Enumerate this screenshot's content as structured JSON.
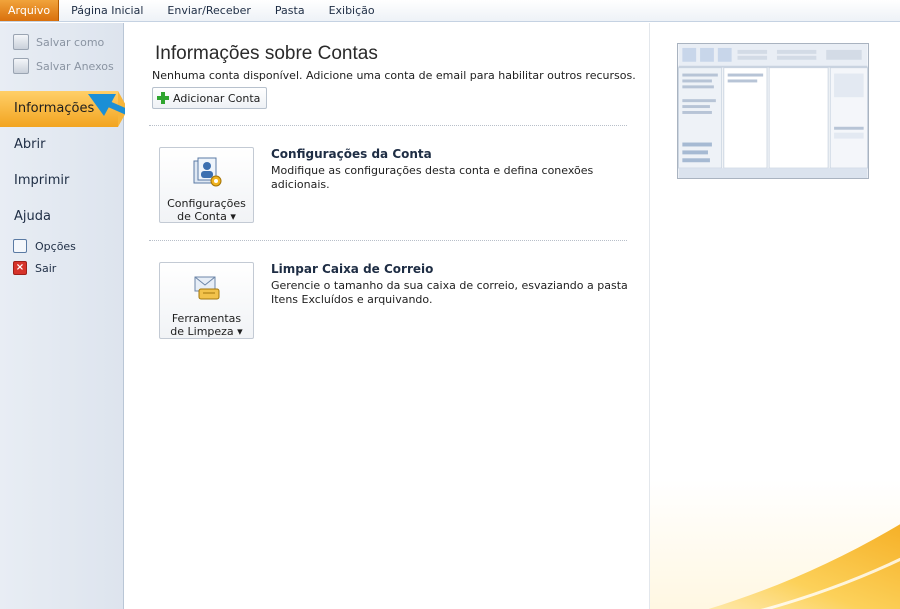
{
  "ribbon": {
    "tabs": [
      "Arquivo",
      "Página Inicial",
      "Enviar/Receber",
      "Pasta",
      "Exibição"
    ]
  },
  "nav": {
    "save_as": "Salvar como",
    "save_attachments": "Salvar Anexos",
    "info": "Informações",
    "open": "Abrir",
    "print": "Imprimir",
    "help": "Ajuda",
    "options": "Opções",
    "exit": "Sair"
  },
  "main": {
    "title": "Informações sobre Contas",
    "subtitle": "Nenhuma conta disponível. Adicione uma conta de email para habilitar outros recursos.",
    "add_account": "Adicionar Conta",
    "settings": {
      "button_line1": "Configurações",
      "button_line2": "de Conta",
      "title": "Configurações da Conta",
      "desc": "Modifique as configurações desta conta e defina conexões adicionais."
    },
    "cleanup": {
      "button_line1": "Ferramentas",
      "button_line2": "de Limpeza",
      "title": "Limpar Caixa de Correio",
      "desc": "Gerencie o tamanho da sua caixa de correio, esvaziando a pasta Itens Excluídos e arquivando."
    }
  },
  "colors": {
    "file_tab": "#e07b14",
    "active_nav": "#f7b53a",
    "annotation_arrow": "#1b8fd6"
  }
}
